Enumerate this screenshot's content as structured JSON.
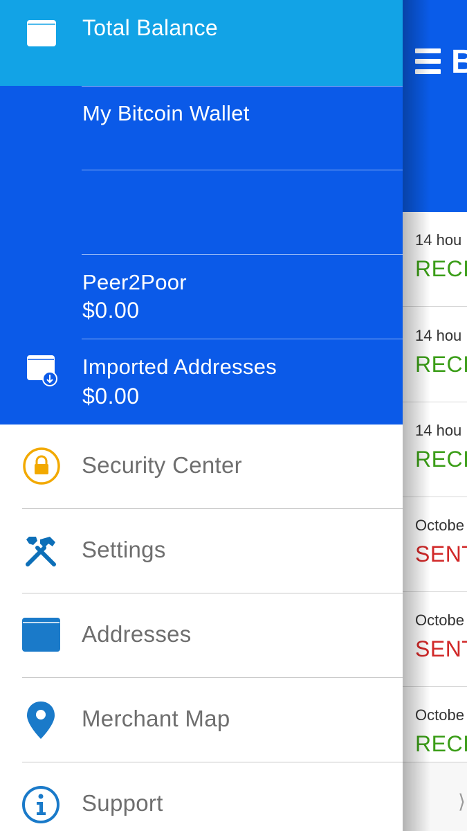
{
  "drawer": {
    "total_balance_label": "Total Balance",
    "wallets": [
      {
        "name": "My Bitcoin Wallet",
        "amount": ""
      },
      {
        "name": "",
        "amount": ""
      },
      {
        "name": "Peer2Poor",
        "amount": "$0.00"
      },
      {
        "name": "Imported Addresses",
        "amount": "$0.00"
      }
    ],
    "menu": [
      {
        "label": "Security Center",
        "icon": "lock-icon",
        "color": "#f2a900"
      },
      {
        "label": "Settings",
        "icon": "tools-icon",
        "color": "#0d6fb8"
      },
      {
        "label": "Addresses",
        "icon": "wallet-icon",
        "color": "#1a7ac9"
      },
      {
        "label": "Merchant Map",
        "icon": "map-pin-icon",
        "color": "#1a7ac9"
      },
      {
        "label": "Support",
        "icon": "info-icon",
        "color": "#1a7ac9"
      }
    ]
  },
  "app": {
    "title": "B",
    "transactions": [
      {
        "time": "14 hou",
        "type": "RECI"
      },
      {
        "time": "14 hou",
        "type": "RECI"
      },
      {
        "time": "14 hou",
        "type": "RECI"
      },
      {
        "time": "Octobe",
        "type": "SENT"
      },
      {
        "time": "Octobe",
        "type": "SENT"
      },
      {
        "time": "Octobe",
        "type": "RECI"
      }
    ]
  },
  "colors": {
    "total_row_bg": "#12a3e6",
    "wallet_bg": "#0b5ae8",
    "received": "#3a9d17",
    "sent": "#d12929"
  }
}
